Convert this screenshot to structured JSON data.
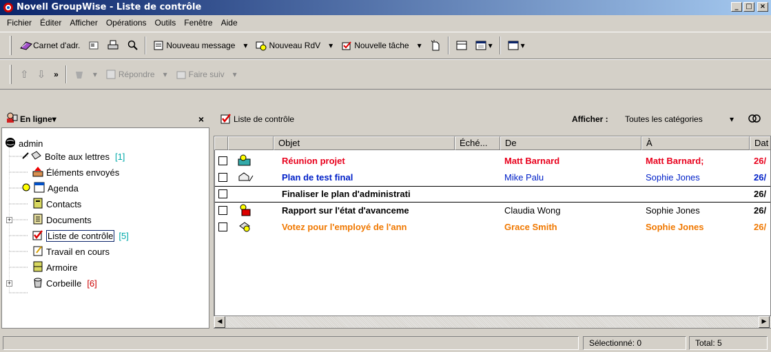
{
  "window": {
    "title": "Novell GroupWise - Liste de contrôle",
    "min": "_",
    "max": "□",
    "close": "×"
  },
  "menubar": [
    "Fichier",
    "Éditer",
    "Afficher",
    "Opérations",
    "Outils",
    "Fenêtre",
    "Aide"
  ],
  "toolbar1": {
    "address_book": "Carnet d'adr.",
    "new_message": "Nouveau message",
    "new_appointment": "Nouveau RdV",
    "new_task": "Nouvelle tâche"
  },
  "toolbar2": {
    "reply": "Répondre",
    "forward": "Faire suiv"
  },
  "left_panel": {
    "mode": "En ligne",
    "close": "×"
  },
  "tree": {
    "root": "admin",
    "items": [
      {
        "label": "Boîte aux lettres",
        "count": "[1]"
      },
      {
        "label": "Éléments envoyés",
        "count": ""
      },
      {
        "label": "Agenda",
        "count": ""
      },
      {
        "label": "Contacts",
        "count": ""
      },
      {
        "label": "Documents",
        "count": ""
      },
      {
        "label": "Liste de contrôle",
        "count": "[5]"
      },
      {
        "label": "Travail en cours",
        "count": ""
      },
      {
        "label": "Armoire",
        "count": ""
      },
      {
        "label": "Corbeille",
        "count": "[6]"
      }
    ]
  },
  "list_header": {
    "title": "Liste de contrôle",
    "show_label": "Afficher :",
    "show_value": "Toutes les catégories"
  },
  "columns": [
    "Objet",
    "Éché...",
    "De",
    "À",
    "Dat"
  ],
  "rows": [
    {
      "subject": "Réunion projet",
      "from": "Matt Barnard",
      "to": "Matt Barnard;",
      "date": "26/",
      "color": "#e8001c",
      "bold": true
    },
    {
      "subject": "Plan de test final",
      "from": "Mike Palu",
      "to": "Sophie Jones",
      "date": "26/",
      "color": "#0020c8",
      "bold": false
    },
    {
      "subject": "Finaliser le plan d'administrati",
      "from": "",
      "to": "",
      "date": "26/",
      "color": "#000000",
      "bold": true
    },
    {
      "subject": "Rapport sur l'état d'avanceme",
      "from": "Claudia Wong",
      "to": "Sophie Jones",
      "date": "26/",
      "color": "#000000",
      "bold": false
    },
    {
      "subject": "Votez pour l'employé de l'ann",
      "from": "Grace Smith",
      "to": "Sophie Jones",
      "date": "26/",
      "color": "#f07800",
      "bold": true
    }
  ],
  "status": {
    "selected": "Sélectionné: 0",
    "total": "Total: 5"
  }
}
